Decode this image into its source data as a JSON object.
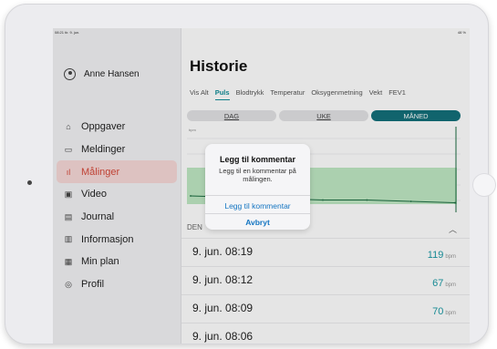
{
  "status_bar": {
    "time": "08:21 tir. 9. jun.",
    "right": "48 %"
  },
  "profile": {
    "name": "Anne Hansen"
  },
  "sidebar": {
    "items": [
      {
        "label": "Oppgaver",
        "icon": "home-icon",
        "glyph": "⌂",
        "active": false
      },
      {
        "label": "Meldinger",
        "icon": "chat-icon",
        "glyph": "▭",
        "active": false
      },
      {
        "label": "Målinger",
        "icon": "chart-icon",
        "glyph": "ıl",
        "active": true
      },
      {
        "label": "Video",
        "icon": "video-icon",
        "glyph": "▣",
        "active": false
      },
      {
        "label": "Journal",
        "icon": "journal-icon",
        "glyph": "▤",
        "active": false
      },
      {
        "label": "Informasjon",
        "icon": "info-icon",
        "glyph": "▥",
        "active": false
      },
      {
        "label": "Min plan",
        "icon": "plan-icon",
        "glyph": "▦",
        "active": false
      },
      {
        "label": "Profil",
        "icon": "profile-icon",
        "glyph": "◎",
        "active": false
      }
    ]
  },
  "main": {
    "title": "Historie",
    "tabs": [
      "Vis Alt",
      "Puls",
      "Blodtrykk",
      "Temperatur",
      "Oksygenmetning",
      "Vekt",
      "FEV1"
    ],
    "active_tab": "Puls",
    "range_tabs": [
      "DAG",
      "UKE",
      "MÅNED"
    ],
    "active_range": "MÅNED",
    "list_header": "DEN"
  },
  "chart_data": {
    "type": "line",
    "ylabel": "bpm",
    "band_color": "#bfe8c3",
    "line_color": "#1a6b40",
    "points": [
      [
        0,
        72
      ],
      [
        1,
        71
      ],
      [
        2,
        70
      ],
      [
        3,
        69
      ],
      [
        4,
        69
      ],
      [
        5,
        68
      ],
      [
        6,
        67
      ]
    ]
  },
  "alert": {
    "title": "Legg til kommentar",
    "message": "Legg til en kommentar på målingen.",
    "confirm": "Legg til kommentar",
    "cancel": "Avbryt"
  },
  "measurements": [
    {
      "time": "9. jun. 08:19",
      "value": "119",
      "unit": "bpm",
      "color": "#1a9aa5"
    },
    {
      "time": "9. jun. 08:12",
      "value": "67",
      "unit": "bpm",
      "color": "#1a9aa5"
    },
    {
      "time": "9. jun. 08:09",
      "value": "70",
      "unit": "bpm",
      "color": "#1a9aa5"
    },
    {
      "time": "9. jun. 08:06",
      "value": "",
      "unit": "",
      "color": "#1a9aa5"
    }
  ],
  "colors": {
    "accent": "#d64a3b",
    "teal": "#138e99"
  }
}
